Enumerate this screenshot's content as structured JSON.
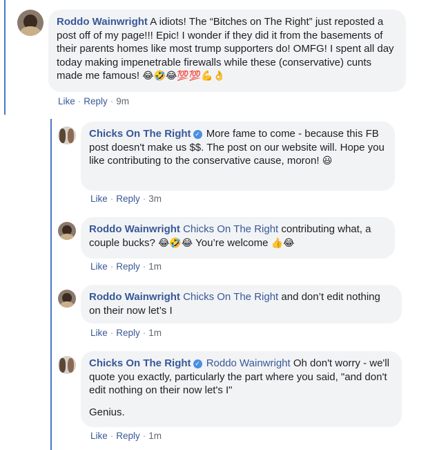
{
  "comments": [
    {
      "author": "Roddo Wainwright",
      "text": "A idiots! The “Bitches on The Right” just reposted a post off of my page!!! Epic! I wonder if they did it from the basements of their parents homes like most trump supporters do! OMFG! I spent all day today making impenetrable firewalls while these (conservative) cunts made me famous!",
      "emoji": "😂🤣😂💯💯💪👌",
      "like": "Like",
      "reply": "Reply",
      "sep": "·",
      "time": "9m"
    }
  ],
  "replies": [
    {
      "author": "Chicks On The Right",
      "verified": true,
      "text": "More fame to come - because this FB post doesn't make us $$. The post on our website will. Hope you like contributing to the conservative cause, moron!",
      "emoji": "😃",
      "like": "Like",
      "reply": "Reply",
      "sep": "·",
      "time": "3m"
    },
    {
      "author": "Roddo Wainwright",
      "mention": "Chicks On The Right",
      "text": "contributing what, a couple bucks?",
      "emoji": "😂🤣😂",
      "text2": "You’re welcome",
      "emoji2": "👍😂",
      "like": "Like",
      "reply": "Reply",
      "sep": "·",
      "time": "1m"
    },
    {
      "author": "Roddo Wainwright",
      "mention": "Chicks On The Right",
      "text": "and don’t edit nothing on their now let’s I",
      "like": "Like",
      "reply": "Reply",
      "sep": "·",
      "time": "1m"
    },
    {
      "author": "Chicks On The Right",
      "verified": true,
      "mention": "Roddo Wainwright",
      "text": "Oh don't worry - we'll quote you exactly, particularly the part where you said, \"and don't edit nothing on their now let's I\"",
      "text2": "Genius.",
      "like": "Like",
      "reply": "Reply",
      "sep": "·",
      "time": "1m"
    }
  ],
  "icons": {
    "verified": "verified-badge-icon",
    "check_glyph": "✓"
  },
  "colors": {
    "link": "#385898",
    "bubble": "#f2f3f5",
    "thread_line": "#4a76c8",
    "meta": "#90949c",
    "verified": "#4a90e2"
  }
}
